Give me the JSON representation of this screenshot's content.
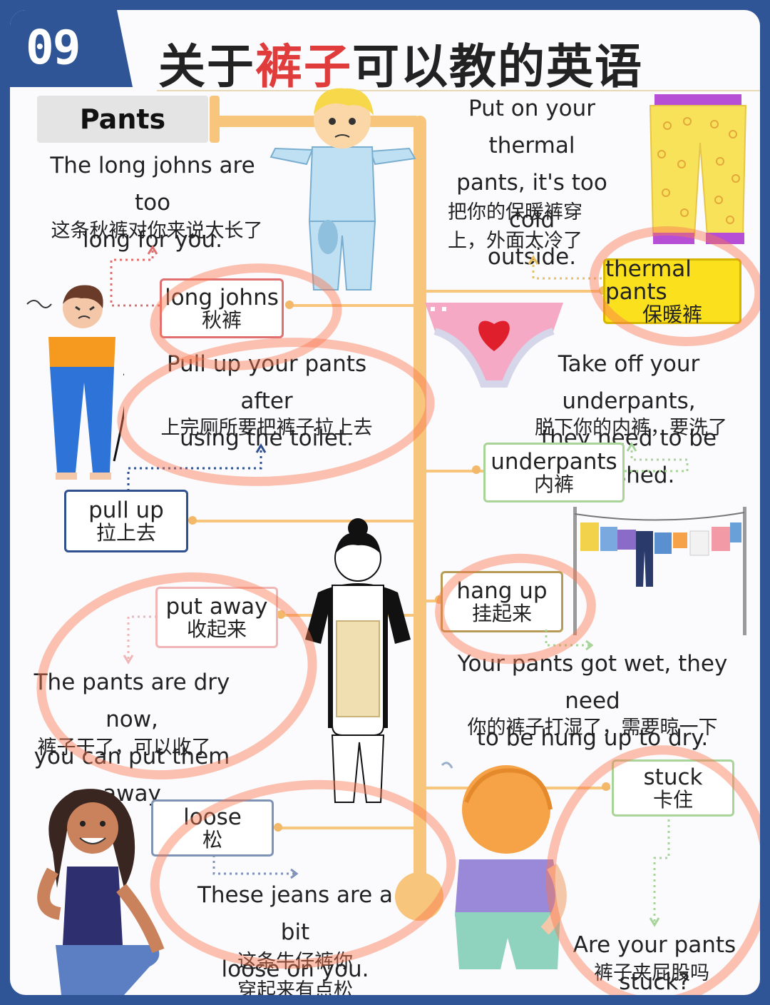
{
  "header": {
    "number": "09",
    "title_part1": "关于",
    "title_highlight": "裤子",
    "title_part2": "可以教的英语",
    "colors": {
      "frame": "#2f5597",
      "highlight": "#e03c3c",
      "branch": "#f7c57b"
    }
  },
  "topic_tag": "Pants",
  "entries": {
    "long_johns": {
      "en": "long johns",
      "zh": "秋裤",
      "sentence_en_1": "The long johns are too",
      "sentence_en_2": "long for you.",
      "sentence_zh": "这条秋裤对你来说太长了"
    },
    "pull_up": {
      "en": "pull up",
      "zh": "拉上去",
      "sentence_en_1": "Pull up your pants after",
      "sentence_en_2": "using the toilet.",
      "sentence_zh": "上完厕所要把裤子拉上去"
    },
    "put_away": {
      "en": "put away",
      "zh": "收起来",
      "sentence_en_1": "The pants are dry now,",
      "sentence_en_2": "you can put them away",
      "sentence_zh": "裤子干了，可以收了"
    },
    "loose": {
      "en": "loose",
      "zh": "松",
      "sentence_en_1": "These jeans are a bit",
      "sentence_en_2": "loose on you.",
      "sentence_zh_1": "这条牛仔裤你",
      "sentence_zh_2": "穿起来有点松"
    },
    "thermal_pants": {
      "en": "thermal pants",
      "zh": "保暖裤",
      "sentence_en_1": "Put on your thermal",
      "sentence_en_2": "pants, it's too cold",
      "sentence_en_3": "outside.",
      "sentence_zh_1": "把你的保暖裤穿",
      "sentence_zh_2": "上，外面太冷了"
    },
    "underpants": {
      "en": "underpants",
      "zh": "内裤",
      "sentence_en_1": "Take off your underpants,",
      "sentence_en_2": "they need to be washed.",
      "sentence_zh": "脱下你的内裤，要洗了"
    },
    "hang_up": {
      "en": "hang up",
      "zh": "挂起来",
      "sentence_en_1": "Your pants got wet, they need",
      "sentence_en_2": "to be hung up to dry.",
      "sentence_zh": "你的裤子打湿了，需要晾一下"
    },
    "stuck": {
      "en": "stuck",
      "zh": "卡住",
      "sentence_en": "Are your pants stuck?",
      "sentence_zh": "裤子夹屁股吗"
    }
  },
  "icons": [
    "boy-in-pajamas",
    "angry-kid",
    "thermal-pants",
    "underpants-heart",
    "woman-with-apron",
    "clothesline",
    "woman-loose-jeans",
    "toddler-stuck-pants"
  ]
}
